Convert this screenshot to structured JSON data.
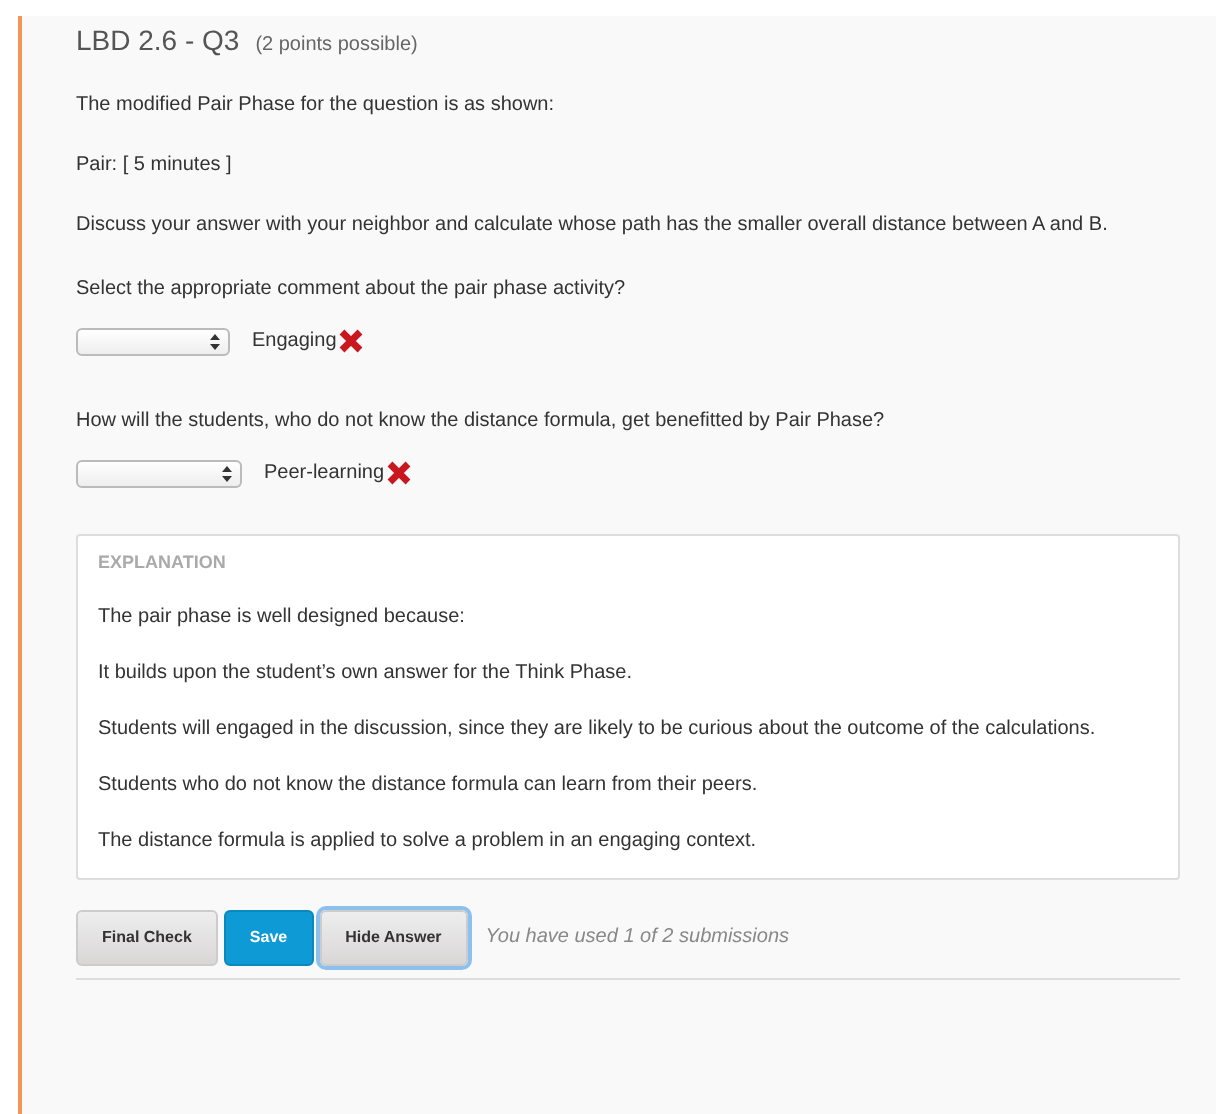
{
  "problem": {
    "title": "LBD 2.6 - Q3",
    "points": "(2 points possible)"
  },
  "paragraphs": [
    "The modified Pair Phase for the question is as shown:",
    "Pair: [ 5 minutes ]",
    "Discuss your answer with your neighbor and calculate whose path has the smaller overall distance between A and B."
  ],
  "questions": [
    {
      "prompt": "Select the appropriate comment about the pair phase activity?",
      "answer": "Engaging",
      "correct": false
    },
    {
      "prompt": "How will the students, who do not know the distance formula, get benefitted by Pair Phase?",
      "answer": "Peer-learning",
      "correct": false
    }
  ],
  "explanation": {
    "heading": "EXPLANATION",
    "paragraphs": [
      "The pair phase is well designed because:",
      "It builds upon the student’s own answer for the Think Phase.",
      "Students will engaged in the discussion, since they are likely to be curious about the outcome of the calculations.",
      "Students who do not know the distance formula can learn from their peers.",
      "The distance formula is applied to solve a problem in an engaging context."
    ]
  },
  "buttons": [
    {
      "label": "Final Check",
      "kind": "default",
      "focused": false
    },
    {
      "label": "Save",
      "kind": "primary",
      "focused": false
    },
    {
      "label": "Hide Answer",
      "kind": "default",
      "focused": true
    }
  ],
  "submissions": "You have used 1 of 2 submissions"
}
